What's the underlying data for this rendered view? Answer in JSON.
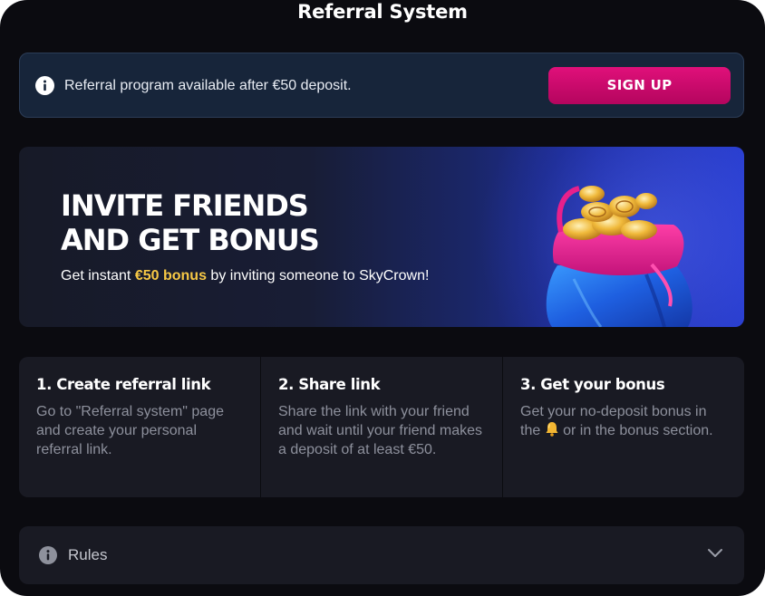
{
  "header": {
    "title": "Referral System"
  },
  "notice": {
    "text": "Referral program available after €50 deposit.",
    "button_label": "SIGN UP",
    "icon": "info-icon"
  },
  "banner": {
    "headline_line1": "INVITE FRIENDS",
    "headline_line2": "AND GET BONUS",
    "sub_prefix": "Get instant ",
    "sub_highlight": "€50 bonus",
    "sub_suffix": " by inviting someone to SkyCrown!",
    "image": "coin-bag-icon"
  },
  "steps": [
    {
      "title": "1. Create referral link",
      "desc": "Go to \"Referral system\" page and create your personal referral link."
    },
    {
      "title": "2. Share link",
      "desc": "Share the link with your friend and wait until your friend makes a deposit of at least €50."
    },
    {
      "title": "3. Get your bonus",
      "desc_before": "Get your no-deposit bonus in the ",
      "desc_icon": "bell-icon",
      "desc_after": " or in the bonus section."
    }
  ],
  "rules": {
    "label": "Rules",
    "icon": "info-icon",
    "toggle_icon": "chevron-down-icon"
  },
  "colors": {
    "background": "#0b0b10",
    "notice_bg": "#17253a",
    "accent": "#d10a6f",
    "highlight": "#f7c845",
    "card_bg": "#191a23",
    "muted_text": "#8d909c"
  }
}
